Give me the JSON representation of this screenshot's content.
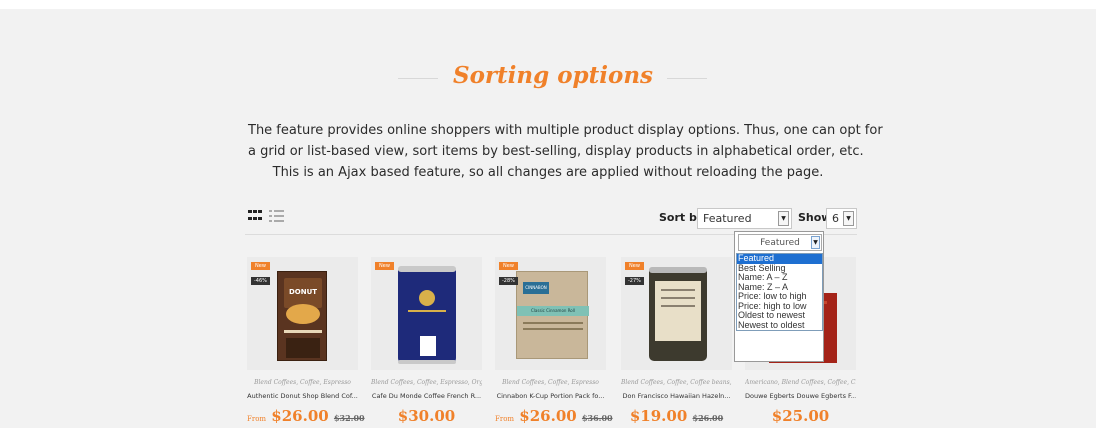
{
  "section": {
    "title": "Sorting options",
    "description_lines": [
      "The feature provides online shoppers with multiple product display options. Thus, one can opt for",
      "a grid or list-based view, sort items by best-selling, display products in alphabetical order, etc.",
      "This is an Ajax based feature, so all changes are applied without reloading the page."
    ]
  },
  "toolbar": {
    "sort_label": "Sort by",
    "sort_value": "Featured",
    "show_label": "Show",
    "show_value": "6"
  },
  "sort_dropdown": {
    "selected": "Featured",
    "options": [
      "Featured",
      "Best Selling",
      "Name: A – Z",
      "Name: Z – A",
      "Price: low to high",
      "Price: high to low",
      "Oldest to newest",
      "Newest to oldest"
    ],
    "highlighted_index": 0
  },
  "products": [
    {
      "badge": "New",
      "discount": "-46%",
      "categories": "Blend Coffees, Coffee, Espresso",
      "name": "Authentic Donut Shop Blend Cof...",
      "price_prefix": "From",
      "price": "$26.00",
      "old_price": "$32.00"
    },
    {
      "badge": "New",
      "discount": "",
      "categories": "Blend Coffees, Coffee, Espresso, Org...",
      "name": "Cafe Du Monde Coffee French R...",
      "price_prefix": "",
      "price": "$30.00",
      "old_price": ""
    },
    {
      "badge": "New",
      "discount": "-28%",
      "categories": "Blend Coffees, Coffee, Espresso",
      "name": "Cinnabon K-Cup Portion Pack fo...",
      "price_prefix": "From",
      "price": "$26.00",
      "old_price": "$36.00"
    },
    {
      "badge": "New",
      "discount": "-27%",
      "categories": "Blend Coffees, Coffee, Coffee beans, ...",
      "name": "Don Francisco Hawaiian Hazeln...",
      "price_prefix": "",
      "price": "$19.00",
      "old_price": "$26.00"
    },
    {
      "badge": "",
      "discount": "",
      "categories": "Americano, Blend Coffees, Coffee, C...",
      "name": "Douwe Egberts Douwe Egberts F...",
      "price_prefix": "",
      "price": "$25.00",
      "old_price": ""
    }
  ],
  "product_art": {
    "p1_brand": "DONUT",
    "p3_brand": "CINNABON",
    "p3_label": "Classic Cinnamon Roll"
  },
  "colors": {
    "accent": "#f0812a",
    "background": "#f2f2f2",
    "dropdown_highlight": "#1e6fd1"
  }
}
